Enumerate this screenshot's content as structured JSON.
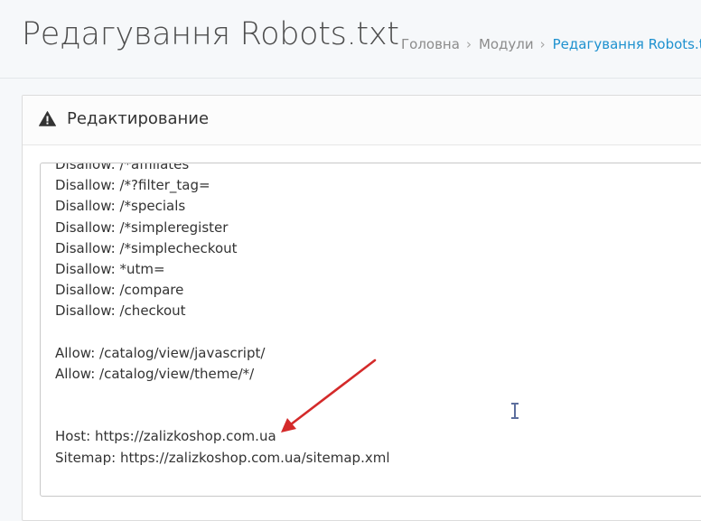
{
  "header": {
    "title": "Редагування Robots.txt",
    "breadcrumb": [
      "Головна",
      "Модули",
      "Редагування Robots.txt"
    ]
  },
  "panel": {
    "title": "Редактирование",
    "icon": "warning-icon"
  },
  "editor": {
    "lines": [
      "Disallow: /*affiliates",
      "Disallow: /*?filter_tag=",
      "Disallow: /*specials",
      "Disallow: /*simpleregister",
      "Disallow: /*simplecheckout",
      "Disallow: *utm=",
      "Disallow: /compare",
      "Disallow: /checkout",
      "",
      "Allow: /catalog/view/javascript/",
      "Allow: /catalog/view/theme/*/",
      "",
      "",
      "Host: https://zalizkoshop.com.ua",
      "Sitemap: https://zalizkoshop.com.ua/sitemap.xml"
    ]
  },
  "colors": {
    "accent": "#1e91cf",
    "annotation_arrow": "#d42a2a"
  }
}
